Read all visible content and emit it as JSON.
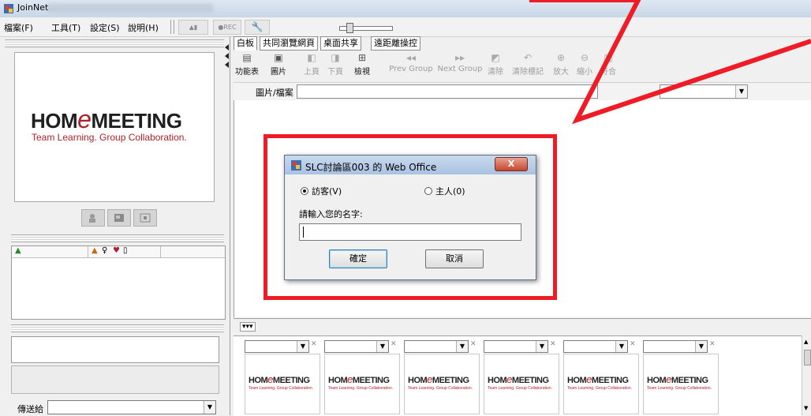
{
  "app": {
    "title": "JoinNet"
  },
  "menu": [
    "檔案(F)",
    "工具(T)",
    "設定(S)",
    "說明(H)"
  ],
  "toolbar": {
    "rec_label": "REC"
  },
  "logo": {
    "text_before": "HOM",
    "text_e": "e",
    "text_after": "MEETING",
    "tagline": "Team Learning. Group Collaboration."
  },
  "tabs": [
    "白板",
    "共同瀏覽網頁",
    "桌面共享",
    "遠距離操控"
  ],
  "ribbon": [
    {
      "label": "功能表",
      "icon": "menu-icon",
      "glyph": "▤",
      "enabled": true
    },
    {
      "label": "圖片",
      "icon": "picture-icon",
      "glyph": "▣",
      "enabled": true
    },
    {
      "label": "上頁",
      "icon": "prev-page-icon",
      "glyph": "◧",
      "enabled": false
    },
    {
      "label": "下頁",
      "icon": "next-page-icon",
      "glyph": "◨",
      "enabled": false
    },
    {
      "label": "檢視",
      "icon": "view-icon",
      "glyph": "⊞",
      "enabled": true
    },
    {
      "label": "Prev Group",
      "icon": "prev-group-icon",
      "glyph": "◂◂",
      "enabled": false
    },
    {
      "label": "Next Group",
      "icon": "next-group-icon",
      "glyph": "▸▸",
      "enabled": false
    },
    {
      "label": "清除",
      "icon": "clear-icon",
      "glyph": "◩",
      "enabled": false
    },
    {
      "label": "清除標記",
      "icon": "clear-marks-icon",
      "glyph": "↶",
      "enabled": false
    },
    {
      "label": "放大",
      "icon": "zoom-in-icon",
      "glyph": "⊕",
      "enabled": false
    },
    {
      "label": "縮小",
      "icon": "zoom-out-icon",
      "glyph": "⊖",
      "enabled": false
    },
    {
      "label": "符合",
      "icon": "fit-icon",
      "glyph": "▥",
      "enabled": false
    }
  ],
  "filebar": {
    "label": "圖片/檔案"
  },
  "dialog": {
    "title": "SLC討論區003 的 Web Office",
    "close_label": "X",
    "radio_guest": "訪客(V)",
    "radio_host": "主人(0)",
    "prompt": "請輸入您的名字:",
    "name_value": "",
    "ok_label": "確定",
    "cancel_label": "取消"
  },
  "thumbstrip": {
    "toggle_label": "▾▾▾"
  },
  "thumbnails": [
    {
      "close_label": "✕"
    },
    {
      "close_label": "✕"
    },
    {
      "close_label": "✕"
    },
    {
      "close_label": "✕"
    },
    {
      "close_label": "✕"
    },
    {
      "close_label": "✕"
    }
  ],
  "sendto": {
    "label": "傳送給"
  },
  "colors": {
    "annotation_red": "#ee1c24",
    "brand_red": "#b2202c"
  }
}
